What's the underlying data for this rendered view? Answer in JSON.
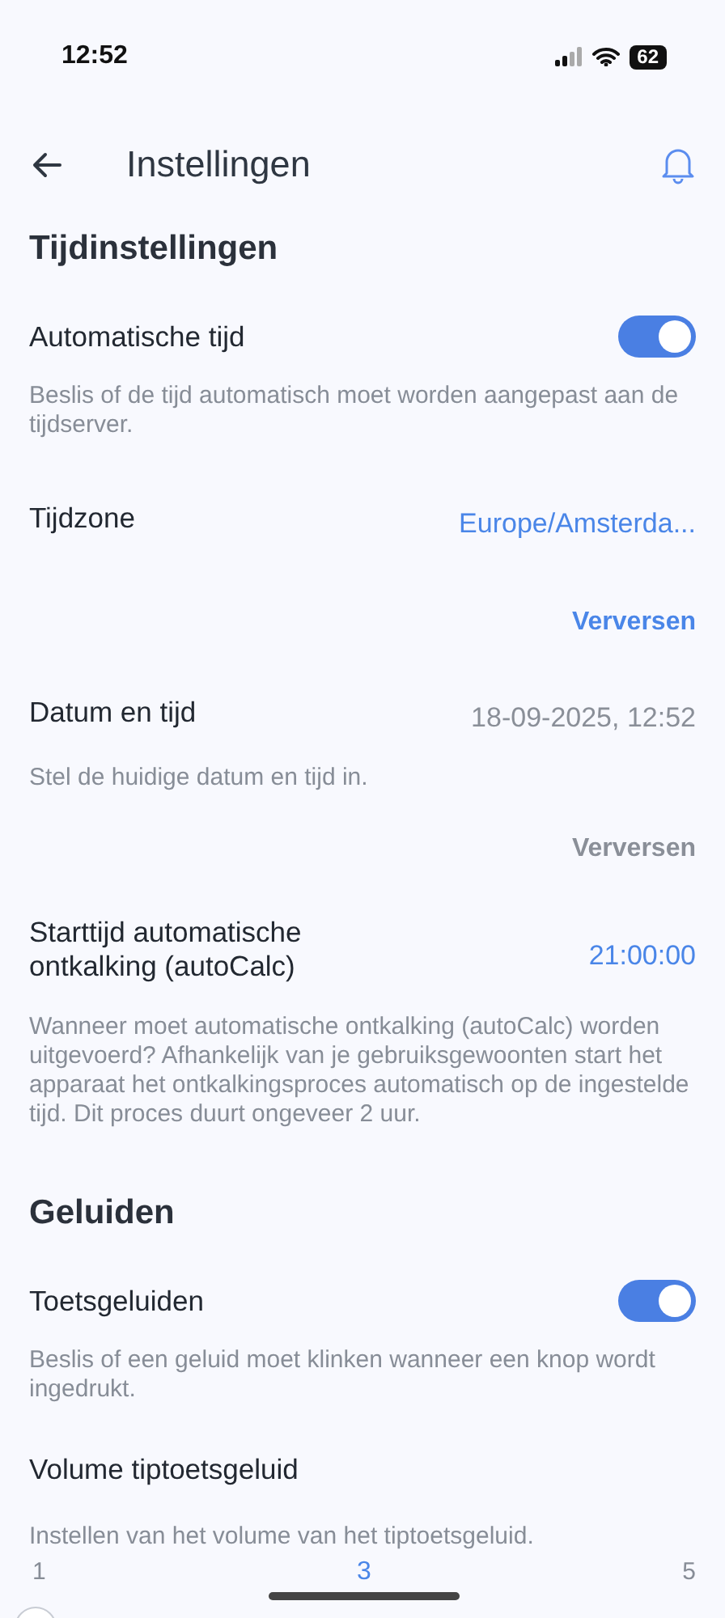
{
  "status_bar": {
    "time": "12:52",
    "battery": "62"
  },
  "header": {
    "title": "Instellingen"
  },
  "sections": [
    {
      "title": "Tijdinstellingen",
      "items": [
        {
          "kind": "toggle",
          "label": "Automatische tijd",
          "on": true,
          "description": "Beslis of de tijd automatisch moet worden aangepast aan de tijdserver."
        },
        {
          "kind": "value",
          "label": "Tijdzone",
          "value": "Europe/Amsterda...",
          "editable": true
        },
        {
          "kind": "button",
          "label": "Verversen",
          "disabled": false
        },
        {
          "kind": "value",
          "label": "Datum en tijd",
          "value": "18-09-2025, 12:52",
          "editable": false,
          "description": "Stel de huidige datum en tijd in."
        },
        {
          "kind": "button",
          "label": "Verversen",
          "disabled": true
        },
        {
          "kind": "value",
          "label": "Starttijd automatische ontkalking (autoCalc)",
          "value": "21:00:00",
          "editable": true,
          "description": "Wanneer moet automatische ontkalking (autoCalc) worden uitgevoerd? Afhankelijk van je gebruiksgewoonten start het apparaat het ontkalkingsproces automatisch op de ingestelde tijd. Dit proces duurt ongeveer 2 uur."
        }
      ]
    },
    {
      "title": "Geluiden",
      "items": [
        {
          "kind": "toggle",
          "label": "Toetsgeluiden",
          "on": true,
          "description": "Beslis of een geluid moet klinken wanneer een knop wordt ingedrukt."
        },
        {
          "kind": "slider",
          "label": "Volume tiptoetsgeluid",
          "description": "Instellen van het volume van het tiptoetsgeluid.",
          "scale": [
            {
              "label": "1",
              "selected": false
            },
            {
              "label": "3",
              "selected": true
            },
            {
              "label": "5",
              "selected": false
            }
          ]
        }
      ]
    }
  ]
}
